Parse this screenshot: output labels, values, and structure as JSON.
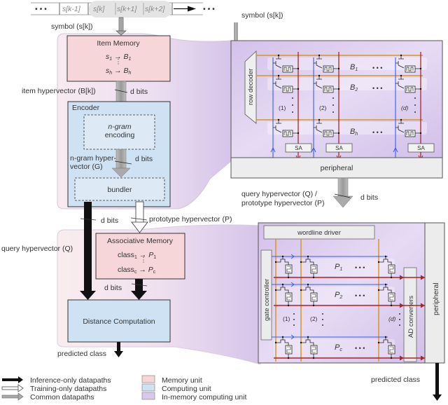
{
  "symbol_stream": {
    "ellipsis": "• • •",
    "cells": [
      "s[k-1]",
      "s[k]",
      "s[k+1]",
      "s[k+2]"
    ],
    "label": "symbol (s[k])"
  },
  "item_memory": {
    "title": "Item Memory",
    "row1_left": "s",
    "row1_left_sub": "1",
    "row1_right": "B",
    "row1_right_sub": "1",
    "rowh_left": "s",
    "rowh_left_sub": "h",
    "rowh_right": "B",
    "rowh_right_sub": "h"
  },
  "labels": {
    "item_hypervector": "item hypervector (B[k])",
    "d_bits": "d bits",
    "ngram_hypervector_1": "n-gram hyper-",
    "ngram_hypervector_2": "vector (G)",
    "prototype_hypervector": "prototype hypervector (P)",
    "query_hypervector": "query hypervector (Q)",
    "predicted_class": "predicted class",
    "query_proto_1": "query hypervector (Q) /",
    "query_proto_2": "prototype hypervector (P)",
    "symbol_right": "symbol (s[k])"
  },
  "encoder": {
    "title": "Encoder",
    "ngram_1": "n-gram",
    "ngram_2": "encoding",
    "bundler": "bundler"
  },
  "associative_memory": {
    "title": "Associative Memory",
    "row1_left": "class",
    "row1_left_sub": "1",
    "row1_right": "P",
    "row1_right_sub": "1",
    "rowc_left": "class",
    "rowc_left_sub": "c",
    "rowc_right": "P",
    "rowc_right_sub": "c"
  },
  "distance": {
    "title": "Distance Computation"
  },
  "imc_top": {
    "row_decoder": "row decoder",
    "rows": [
      {
        "name": "B",
        "sub": "1"
      },
      {
        "name": "B",
        "sub": "2"
      },
      {
        "name": "B",
        "sub": "h"
      }
    ],
    "cols": [
      "(1)",
      "(2)",
      "(d)"
    ],
    "sa": "SA",
    "peripheral": "peripheral",
    "ellipsis": "• • •"
  },
  "imc_bottom": {
    "wordline_driver": "wordline driver",
    "gate_controller": "gate  controller",
    "ad_converters": "AD converters",
    "peripheral": "peripheral",
    "rows": [
      {
        "name": "P",
        "sub": "1"
      },
      {
        "name": "P",
        "sub": "2"
      },
      {
        "name": "P",
        "sub": "c"
      }
    ],
    "cols": [
      "(1)",
      "(2)",
      "(d)"
    ],
    "ellipsis": "• • •"
  },
  "legend": {
    "arrows": [
      {
        "label": "Inference-only datapaths",
        "style": "black"
      },
      {
        "label": "Training-only datapaths",
        "style": "white"
      },
      {
        "label": "Common datapaths",
        "style": "gray"
      }
    ],
    "units": [
      {
        "label": "Memory unit",
        "color": "#f6d6d8"
      },
      {
        "label": "Computing unit",
        "color": "#cfe2f3"
      },
      {
        "label": "In-memory computing unit",
        "color": "#d9c7ec"
      }
    ]
  },
  "colors": {
    "memory": "#f6d6d8",
    "computing": "#cfe2f3",
    "imc": "#dccdee",
    "wordline": "#d4971f",
    "bitline_blue": "#3a5cf0",
    "bitline_red": "#a8262a",
    "arrow_gray": "#a8a8a8"
  }
}
